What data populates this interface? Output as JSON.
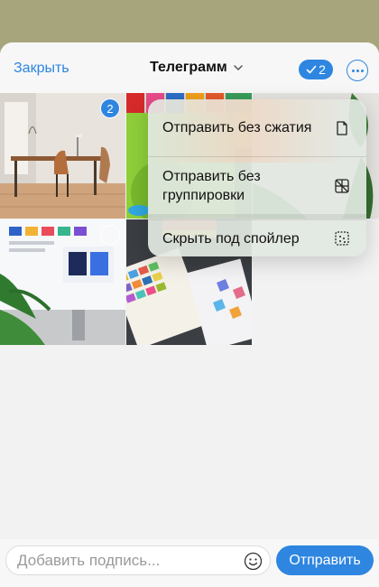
{
  "header": {
    "close_label": "Закрыть",
    "title": "Телеграмм",
    "selected_count": "2",
    "title_icon": "chevron-down-icon",
    "more_icon": "ellipsis-icon"
  },
  "photos": [
    {
      "subject": "desk-and-chair-room",
      "selected": true,
      "selection_number": "2"
    },
    {
      "subject": "color-swatch-shelf-with-plant",
      "selected": false
    },
    {
      "subject": "monitor-with-design-system",
      "selected": false
    },
    {
      "subject": "color-palette-cards-and-tablet",
      "selected": false
    }
  ],
  "menu": {
    "items": [
      {
        "label": "Отправить без сжатия",
        "icon": "document-icon"
      },
      {
        "label": "Отправить без группировки",
        "icon": "ungroup-icon"
      },
      {
        "label": "Скрыть под спойлер",
        "icon": "spoiler-icon"
      }
    ]
  },
  "footer": {
    "caption_placeholder": "Добавить подпись...",
    "caption_value": "",
    "send_label": "Отправить",
    "emoji_icon": "smiley-icon"
  },
  "colors": {
    "accent": "#2e86e0",
    "sheet_background": "#f2f2f2",
    "backdrop": "#a7a57c"
  }
}
